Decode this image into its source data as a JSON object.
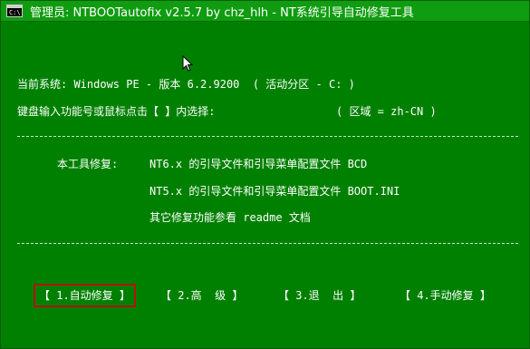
{
  "window": {
    "title": "管理员:  NTBOOTautofix v2.5.7 by chz_hlh - NT系统引导自动修复工具",
    "icon_label": "C:\\"
  },
  "console": {
    "system_line": "当前系统: Windows PE - 版本 6.2.9200  ( 活动分区 - C: )",
    "prompt_line": "键盘输入功能号或鼠标点击【 】内选择:",
    "region_line": "( 区域 = zh-CN )",
    "separator": "------------------------------------------------------------------------------------------------",
    "features_label": "本工具修复:",
    "feature_1": "NT6.x 的引导文件和引导菜单配置文件 BCD",
    "feature_2": "NT5.x 的引导文件和引导菜单配置文件 BOOT.INI",
    "feature_3": "其它修复功能参看 readme 文档"
  },
  "menu": {
    "items": [
      {
        "label": "【 1.自动修复 】",
        "selected": true
      },
      {
        "label": "【 2.高  级 】",
        "selected": false
      },
      {
        "label": "【 3.退  出 】",
        "selected": false
      },
      {
        "label": "【 4.手动修复 】",
        "selected": false
      }
    ]
  },
  "colors": {
    "background": "#008000",
    "text": "#ffffff",
    "selection_border": "#b31313"
  }
}
